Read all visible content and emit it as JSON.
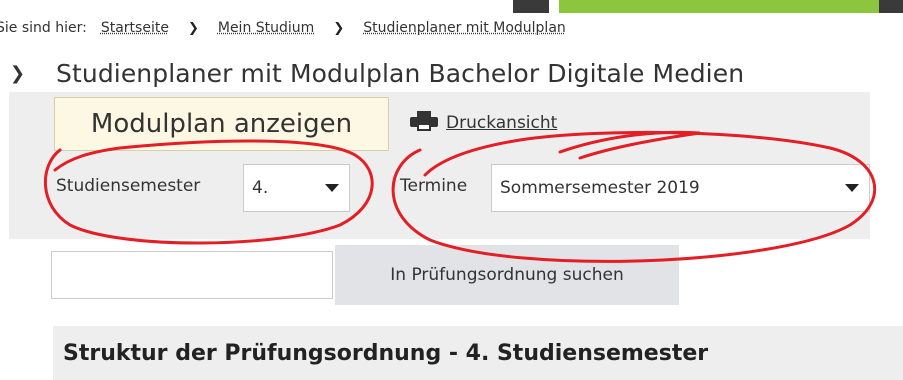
{
  "colors": {
    "topbar_dark": "#3a3a3a",
    "topbar_light": "#d9d9d9",
    "topbar_green": "#8cc63f",
    "panel_bg": "#eeeeee",
    "tab_bg": "#fcf8e3",
    "button_bg": "#e1e3e6",
    "annotation_red": "#e31e24"
  },
  "breadcrumb": {
    "prefix": "Sie sind hier:",
    "items": [
      "Startseite",
      "Mein Studium",
      "Studienplaner mit Modulplan"
    ]
  },
  "page": {
    "title": "Studienplaner mit Modulplan Bachelor Digitale Medien"
  },
  "tabs": {
    "active_label": "Modulplan anzeigen",
    "print_label": "Druckansicht",
    "print_icon": "printer-icon"
  },
  "filters": {
    "semester_label": "Studiensemester",
    "semester_value": "4.",
    "termine_label": "Termine",
    "termine_value": "Sommersemester 2019"
  },
  "search": {
    "input_value": "",
    "button_label": "In Prüfungsordnung suchen"
  },
  "section": {
    "heading": "Struktur der Prüfungsordnung - 4. Studiensemester"
  }
}
